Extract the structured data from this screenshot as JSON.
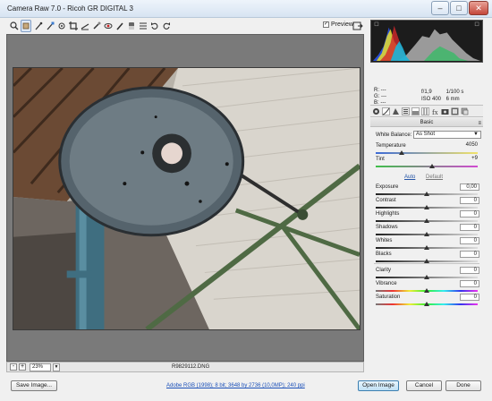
{
  "window": {
    "title": "Camera Raw 7.0  -  Ricoh GR DIGITAL 3",
    "minimize": "–",
    "maximize": "□",
    "close": "✕"
  },
  "toolbar": {
    "tools": [
      "zoom-icon",
      "hand-icon",
      "white-balance-icon",
      "color-sampler-icon",
      "targeted-adjustment-icon",
      "crop-icon",
      "straighten-icon",
      "spot-removal-icon",
      "red-eye-icon",
      "adjustment-brush-icon",
      "graduated-filter-icon",
      "preferences-icon",
      "rotate-left-icon",
      "rotate-right-icon"
    ],
    "preview_label": "Preview",
    "preview_checked": "✓"
  },
  "readout": {
    "r_label": "R:",
    "r_value": "---",
    "g_label": "G:",
    "g_value": "---",
    "b_label": "B:",
    "b_value": "---",
    "aperture": "f/1,9",
    "shutter": "1/100 s",
    "iso": "ISO 400",
    "focal": "6 mm"
  },
  "panel": {
    "title": "Basic",
    "menu_icon": "≡",
    "white_balance_label": "White Balance:",
    "white_balance_value": "As Shot",
    "temperature_label": "Temperature",
    "temperature_value": "4050",
    "tint_label": "Tint",
    "tint_value": "+9",
    "auto_label": "Auto",
    "default_label": "Default",
    "adjustments": [
      {
        "label": "Exposure",
        "value": "0,00"
      },
      {
        "label": "Contrast",
        "value": "0"
      },
      {
        "label": "Highlights",
        "value": "0"
      },
      {
        "label": "Shadows",
        "value": "0"
      },
      {
        "label": "Whites",
        "value": "0"
      },
      {
        "label": "Blacks",
        "value": "0"
      }
    ],
    "presence": [
      {
        "label": "Clarity",
        "value": "0"
      },
      {
        "label": "Vibrance",
        "value": "0"
      },
      {
        "label": "Saturation",
        "value": "0"
      }
    ],
    "temperature_position": 0.25,
    "tint_position": 0.55
  },
  "status": {
    "zoom_value": "23%",
    "zoom_out": "-",
    "zoom_in": "+",
    "filename": "R9829112.DNG"
  },
  "bottom": {
    "save_label": "Save Image...",
    "workflow_link": "Adobe RGB (1998); 8 bit; 3648 by 2736 (10,0MP); 240 ppi",
    "open_label": "Open Image",
    "cancel_label": "Cancel",
    "done_label": "Done"
  }
}
